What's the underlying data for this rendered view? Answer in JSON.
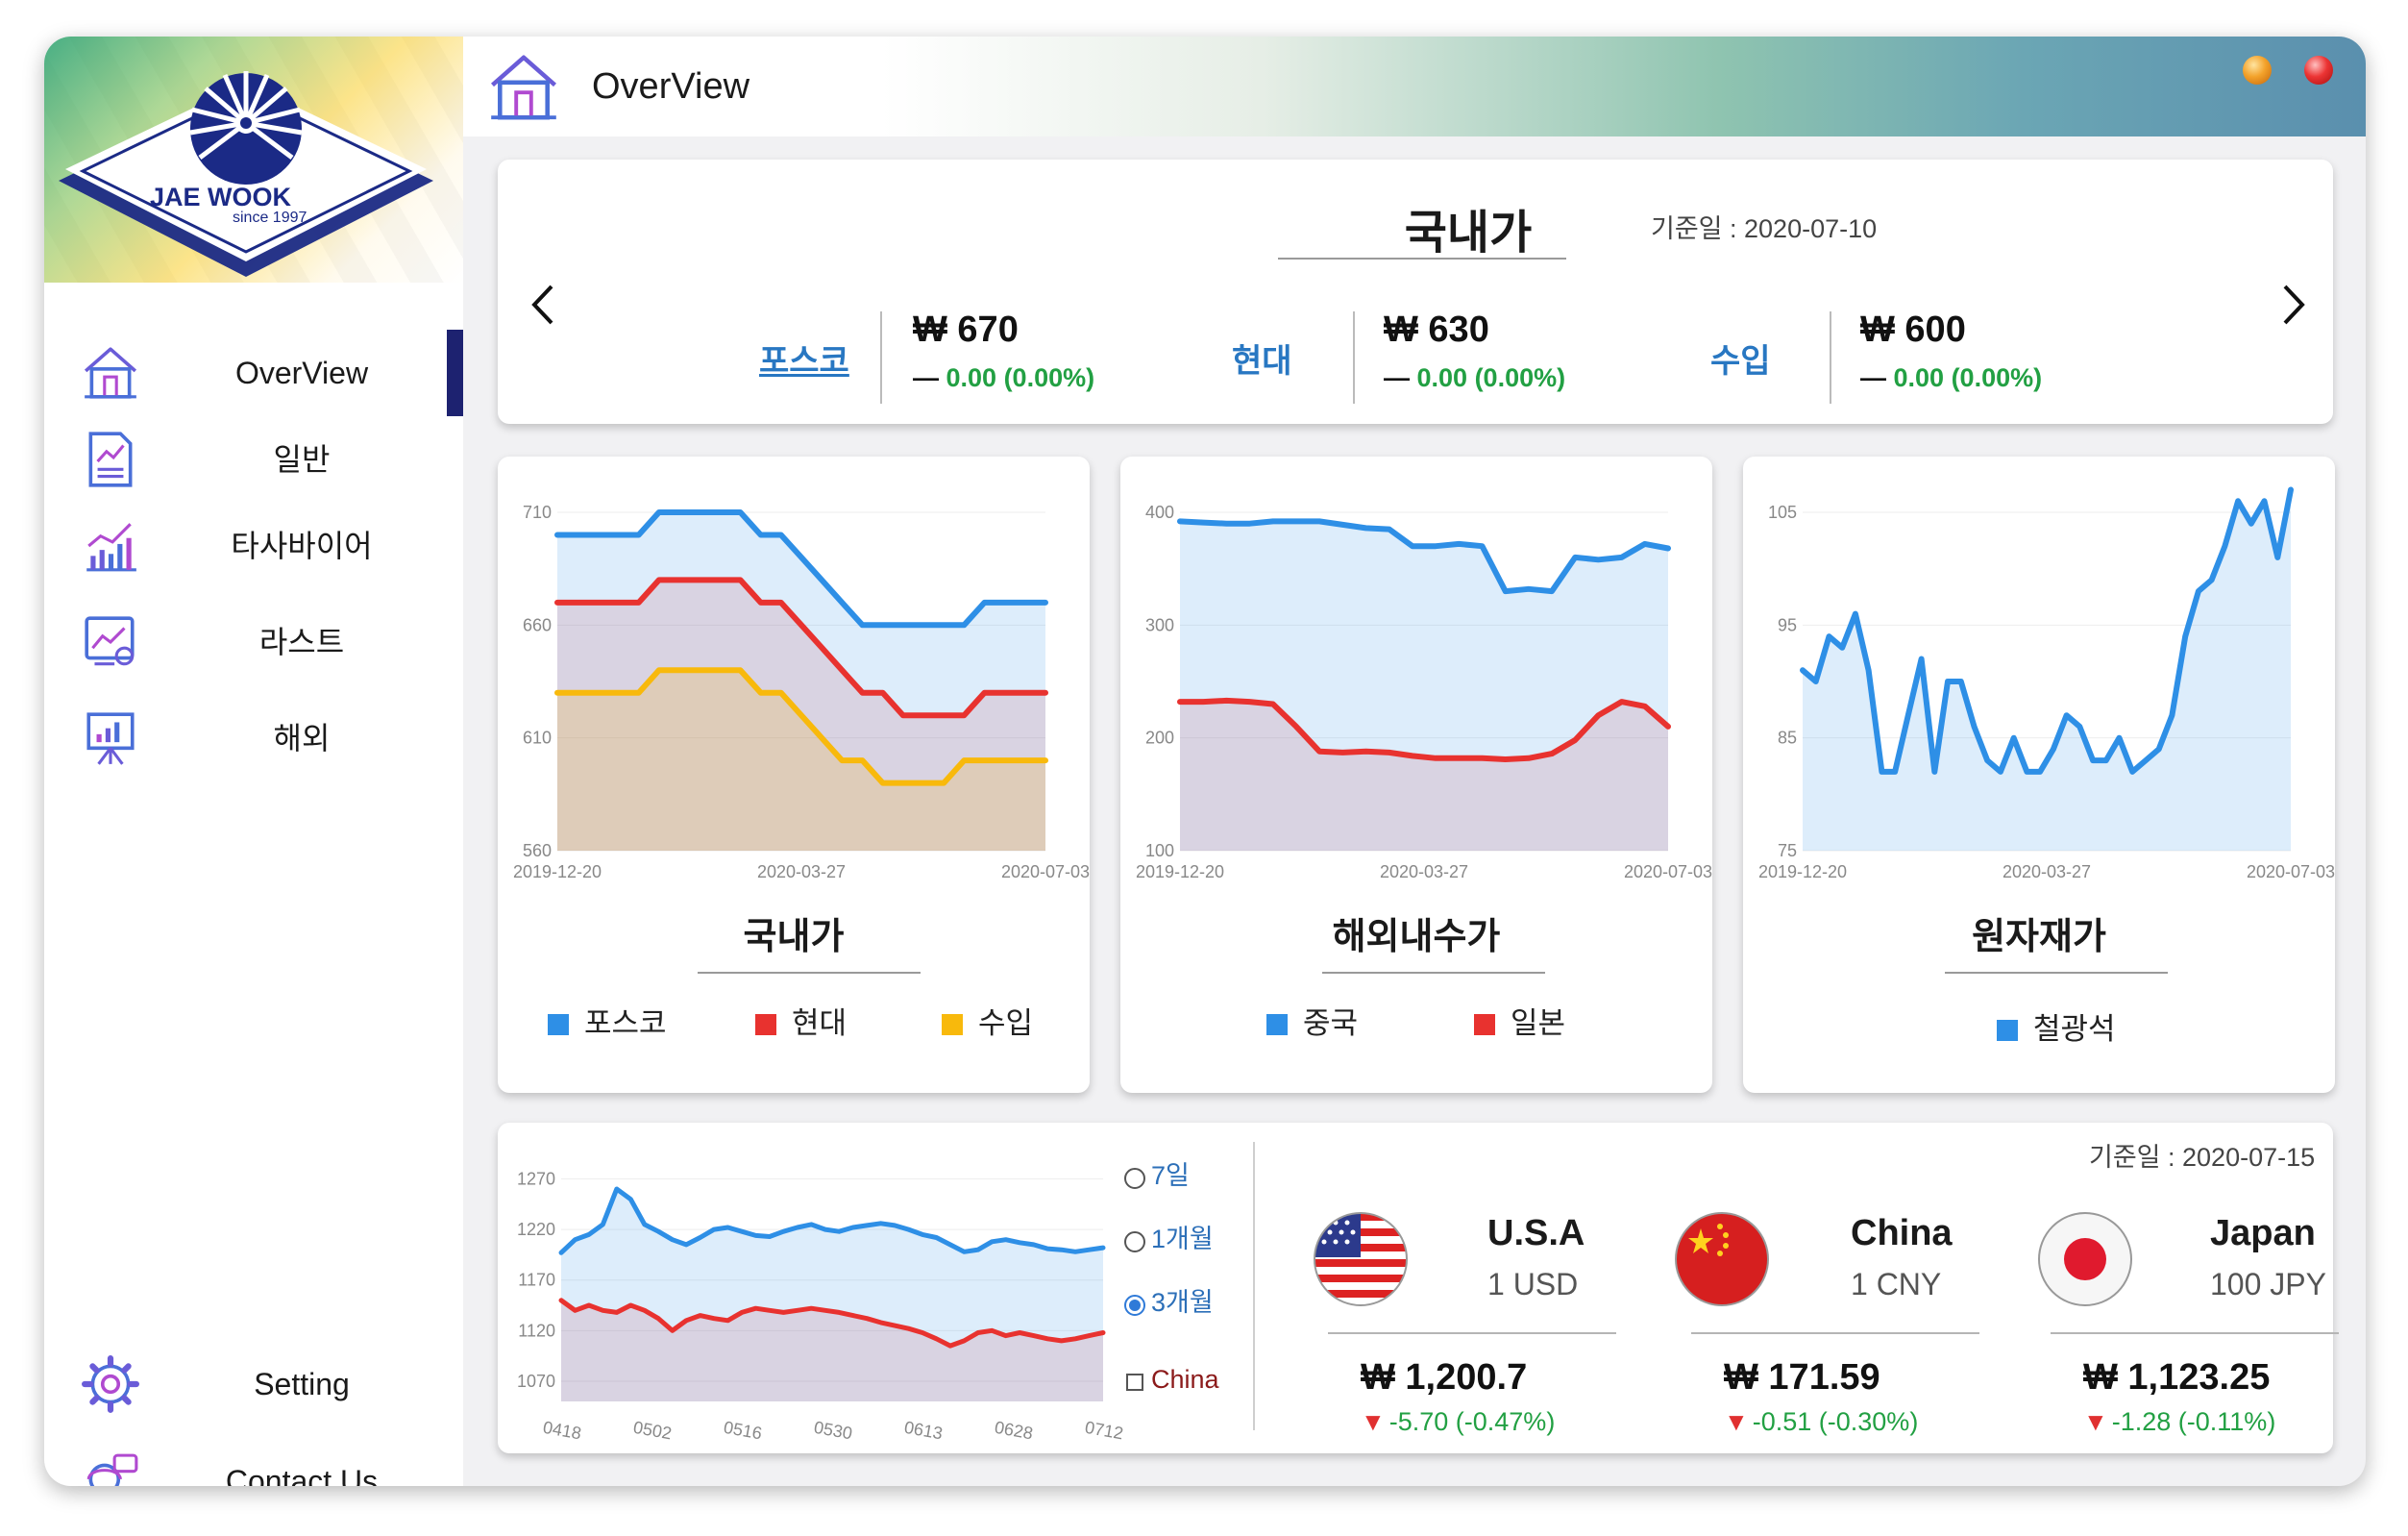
{
  "logo": {
    "name": "JAE WOOK",
    "since": "since 1997"
  },
  "nav": [
    {
      "label": "OverView",
      "icon": "home-icon"
    },
    {
      "label": "일반",
      "icon": "document-chart-icon"
    },
    {
      "label": "타사바이어",
      "icon": "bar-chart-icon"
    },
    {
      "label": "라스트",
      "icon": "presentation-icon"
    },
    {
      "label": "해외",
      "icon": "easel-chart-icon"
    }
  ],
  "nav_bottom": [
    {
      "label": "Setting",
      "icon": "gear-icon"
    },
    {
      "label": "Contact Us",
      "icon": "support-icon"
    }
  ],
  "titlebar": {
    "title": "OverView"
  },
  "domestic": {
    "title": "국내가",
    "date": "기준일 : 2020-07-10",
    "items": [
      {
        "name": "포스코",
        "value": "₩ 670",
        "change": "0.00 (0.00%)"
      },
      {
        "name": "현대",
        "value": "₩ 630",
        "change": "0.00 (0.00%)"
      },
      {
        "name": "수입",
        "value": "₩ 600",
        "change": "0.00 (0.00%)"
      }
    ]
  },
  "charts": [
    {
      "title": "국내가",
      "yticks": [
        "710",
        "660",
        "610",
        "560"
      ],
      "xticks": [
        "2019-12-20",
        "2020-03-27",
        "2020-07-03"
      ],
      "legend": [
        "포스코",
        "현대",
        "수입"
      ]
    },
    {
      "title": "해외내수가",
      "yticks": [
        "400",
        "300",
        "200",
        "100"
      ],
      "xticks": [
        "2019-12-20",
        "2020-03-27",
        "2020-07-03"
      ],
      "legend": [
        "중국",
        "일본"
      ]
    },
    {
      "title": "원자재가",
      "yticks": [
        "105",
        "95",
        "85",
        "75"
      ],
      "xticks": [
        "2019-12-20",
        "2020-03-27",
        "2020-07-03"
      ],
      "legend": [
        "철광석"
      ]
    }
  ],
  "chart_data": [
    {
      "type": "area",
      "title": "국내가",
      "ylim": [
        560,
        710
      ],
      "x_range": [
        "2019-12-20",
        "2020-07-03"
      ],
      "series": [
        {
          "name": "포스코",
          "color": "#2e8fe6",
          "values": [
            700,
            700,
            700,
            700,
            700,
            710,
            710,
            710,
            710,
            710,
            700,
            700,
            690,
            680,
            670,
            660,
            660,
            660,
            660,
            660,
            660,
            670,
            670,
            670,
            670
          ]
        },
        {
          "name": "현대",
          "color": "#e8322f",
          "values": [
            670,
            670,
            670,
            670,
            670,
            680,
            680,
            680,
            680,
            680,
            670,
            670,
            660,
            650,
            640,
            630,
            630,
            620,
            620,
            620,
            620,
            630,
            630,
            630,
            630
          ]
        },
        {
          "name": "수입",
          "color": "#f8b90c",
          "values": [
            630,
            630,
            630,
            630,
            630,
            640,
            640,
            640,
            640,
            640,
            630,
            630,
            620,
            610,
            600,
            600,
            590,
            590,
            590,
            590,
            600,
            600,
            600,
            600,
            600
          ]
        }
      ]
    },
    {
      "type": "area",
      "title": "해외내수가",
      "ylim": [
        100,
        400
      ],
      "x_range": [
        "2019-12-20",
        "2020-07-03"
      ],
      "series": [
        {
          "name": "중국",
          "color": "#2e8fe6",
          "values": [
            392,
            391,
            390,
            390,
            392,
            392,
            392,
            389,
            386,
            385,
            370,
            370,
            372,
            370,
            330,
            332,
            330,
            360,
            358,
            360,
            372,
            368
          ]
        },
        {
          "name": "일본",
          "color": "#e8322f",
          "values": [
            232,
            232,
            233,
            232,
            230,
            210,
            188,
            187,
            188,
            187,
            184,
            182,
            182,
            182,
            181,
            182,
            186,
            198,
            220,
            232,
            228,
            210
          ]
        }
      ]
    },
    {
      "type": "area",
      "title": "원자재가",
      "ylim": [
        75,
        105
      ],
      "x_range": [
        "2019-12-20",
        "2020-07-03"
      ],
      "series": [
        {
          "name": "철광석",
          "color": "#2e8fe6",
          "values": [
            91,
            90,
            94,
            93,
            96,
            91,
            82,
            82,
            87,
            92,
            82,
            90,
            90,
            86,
            83,
            82,
            85,
            82,
            82,
            84,
            87,
            86,
            83,
            83,
            85,
            82,
            83,
            84,
            87,
            94,
            98,
            99,
            102,
            106,
            104,
            106,
            101,
            107
          ]
        }
      ]
    },
    {
      "type": "area",
      "title": "",
      "ylim": [
        1050,
        1280
      ],
      "x_ticks": [
        "0418",
        "0502",
        "0516",
        "0530",
        "0613",
        "0628",
        "0712"
      ],
      "series": [
        {
          "name": "",
          "color": "#2e8fe6",
          "values": [
            1197,
            1210,
            1215,
            1225,
            1260,
            1250,
            1225,
            1218,
            1210,
            1205,
            1212,
            1220,
            1222,
            1218,
            1214,
            1213,
            1218,
            1222,
            1225,
            1220,
            1218,
            1222,
            1224,
            1226,
            1224,
            1220,
            1215,
            1212,
            1205,
            1198,
            1200,
            1208,
            1210,
            1207,
            1205,
            1201,
            1200,
            1198,
            1200,
            1202
          ]
        },
        {
          "name": "",
          "color": "#e8322f",
          "values": [
            1150,
            1140,
            1145,
            1140,
            1138,
            1145,
            1140,
            1132,
            1120,
            1130,
            1135,
            1132,
            1130,
            1138,
            1142,
            1140,
            1138,
            1140,
            1142,
            1140,
            1138,
            1135,
            1132,
            1128,
            1125,
            1122,
            1118,
            1112,
            1105,
            1110,
            1118,
            1120,
            1115,
            1118,
            1115,
            1112,
            1110,
            1112,
            1115,
            1118
          ]
        }
      ]
    }
  ],
  "fx_chart": {
    "yticks": [
      "1270",
      "1220",
      "1170",
      "1120",
      "1070"
    ],
    "xticks": [
      "0418",
      "0502",
      "0516",
      "0530",
      "0613",
      "0628",
      "0712"
    ]
  },
  "fx_controls": {
    "radios": [
      {
        "label": "7일",
        "selected": false
      },
      {
        "label": "1개월",
        "selected": false
      },
      {
        "label": "3개월",
        "selected": true
      }
    ],
    "checkbox": {
      "label": "China",
      "checked": false
    }
  },
  "fx": {
    "date": "기준일 : 2020-07-15",
    "items": [
      {
        "country": "U.S.A",
        "unit": "1 USD",
        "value": "₩ 1,200.7",
        "change": "-5.70 (-0.47%)",
        "flag": "usa-flag-icon"
      },
      {
        "country": "China",
        "unit": "1 CNY",
        "value": "₩ 171.59",
        "change": "-0.51 (-0.30%)",
        "flag": "china-flag-icon"
      },
      {
        "country": "Japan",
        "unit": "100 JPY",
        "value": "₩ 1,123.25",
        "change": "-1.28 (-0.11%)",
        "flag": "japan-flag-icon"
      }
    ]
  }
}
